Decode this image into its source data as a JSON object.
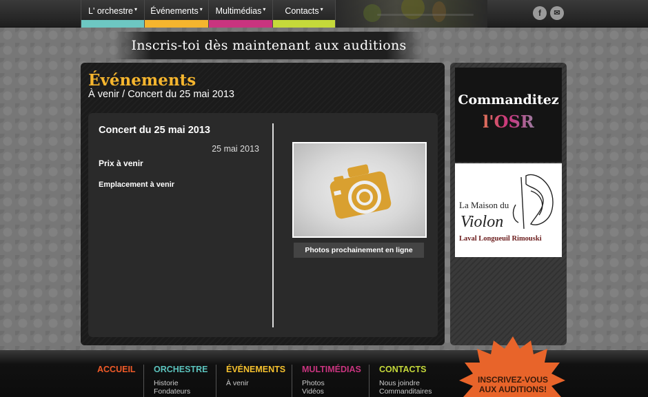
{
  "colors": {
    "accent_orange": "#f5b52e",
    "nav_teal": "#6dc7c2",
    "nav_yellow": "#f5b52e",
    "nav_magenta": "#c9347f",
    "nav_green": "#c5d93a",
    "footer_orange": "#f05a28",
    "footer_teal": "#5bc3bd",
    "footer_yellow": "#f5c12e",
    "footer_magenta": "#c9347f",
    "burst": "#e8642a"
  },
  "nav": {
    "items": [
      {
        "label": "L' orchestre"
      },
      {
        "label": "Événements"
      },
      {
        "label": "Multimédias"
      },
      {
        "label": "Contacts"
      }
    ]
  },
  "social": {
    "facebook": "f",
    "email": "✉"
  },
  "banner": {
    "text": "Inscris-toi dès maintenant aux auditions"
  },
  "main": {
    "title": "Événements",
    "breadcrumb": "À venir / Concert du 25 mai 2013",
    "event": {
      "title": "Concert du 25 mai 2013",
      "date": "25 mai 2013",
      "price": "Prix à venir",
      "place": "Emplacement à venir"
    },
    "photo_button": "Photos prochainement en ligne"
  },
  "sidebar": {
    "sponsor1_line1": "Commanditez",
    "sponsor1_line2": "l'OSR",
    "sponsor2_line1": "La Maison du",
    "sponsor2_line2": "Violon",
    "sponsor2_line3": "Laval Longueuil Rimouski"
  },
  "footer": {
    "accueil": "ACCUEIL",
    "orchestre": "ORCHESTRE",
    "orchestre_links": [
      "Historie",
      "Fondateurs"
    ],
    "evenements": "ÉVÉNEMENTS",
    "evenements_links": [
      "À venir"
    ],
    "multimedias": "MULTIMÉDIAS",
    "multimedias_links": [
      "Photos",
      "Vidéos"
    ],
    "contacts": "CONTACTS",
    "contacts_links": [
      "Nous joindre",
      "Commanditaires"
    ],
    "cta_line1": "INSCRIVEZ-VOUS",
    "cta_line2": "AUX AUDITIONS!"
  }
}
